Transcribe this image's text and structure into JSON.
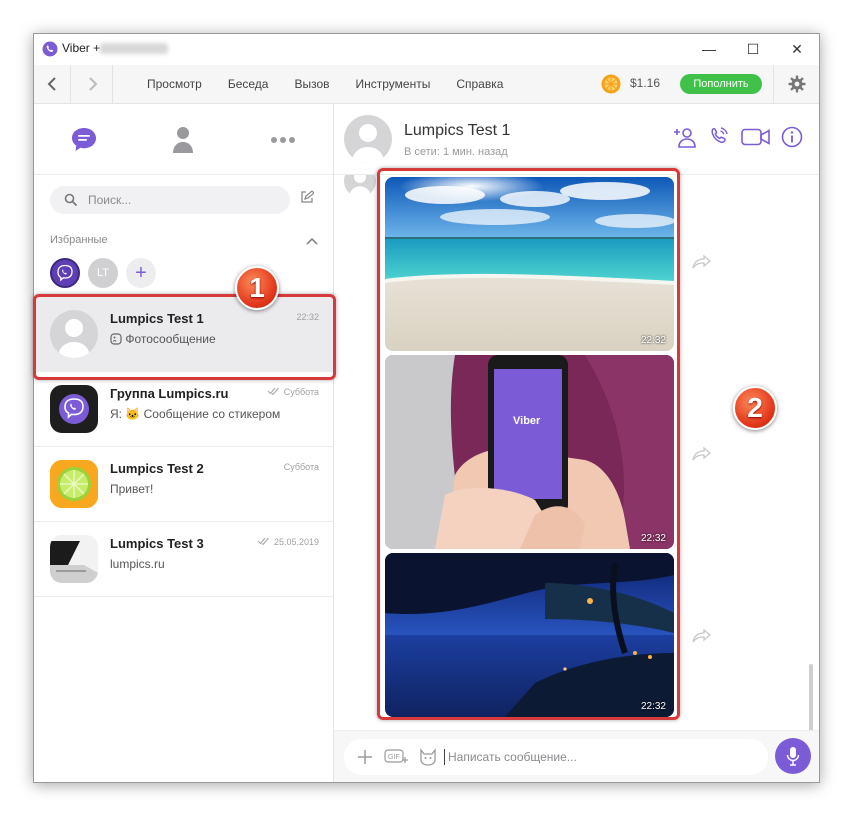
{
  "window": {
    "title": "Viber +",
    "minimize": "—",
    "maximize": "☐",
    "close": "✕"
  },
  "menubar": {
    "items": [
      "Просмотр",
      "Беседа",
      "Вызов",
      "Инструменты",
      "Справка"
    ],
    "balance": "$1.16",
    "topup_label": "Пополнить"
  },
  "sidebar": {
    "search_placeholder": "Поиск...",
    "favorites_label": "Избранные",
    "favorites": [
      {
        "icon": "viber-icon",
        "label": ""
      },
      {
        "icon": "initials",
        "label": "LT"
      },
      {
        "icon": "plus-icon",
        "label": "+"
      }
    ],
    "chats": [
      {
        "name": "Lumpics Test 1",
        "preview": "Фотосообщение",
        "time": "22:32",
        "icon": "photo-icon",
        "selected": true
      },
      {
        "name": "Группа Lumpics.ru",
        "preview": "Я: 🐱 Сообщение со стикером",
        "time": "Суббота",
        "read": true
      },
      {
        "name": "Lumpics Test 2",
        "preview": "Привет!",
        "time": "Суббота"
      },
      {
        "name": "Lumpics Test 3",
        "preview": "lumpics.ru",
        "time": "25.05.2019",
        "read": true
      }
    ]
  },
  "conversation": {
    "contact_name": "Lumpics Test 1",
    "status": "В сети: 1 мин. назад",
    "photos": [
      {
        "subject": "beach",
        "time": "22:32"
      },
      {
        "subject": "phone-viber",
        "time": "22:32"
      },
      {
        "subject": "night-tree",
        "time": "22:32"
      }
    ],
    "phone_screen_text": "Viber",
    "input_placeholder": "Написать сообщение..."
  },
  "annotations": {
    "badge1": "1",
    "badge2": "2",
    "color": "#d73a3a"
  },
  "colors": {
    "brand": "#7c5cd6",
    "topup": "#3fc14a"
  }
}
